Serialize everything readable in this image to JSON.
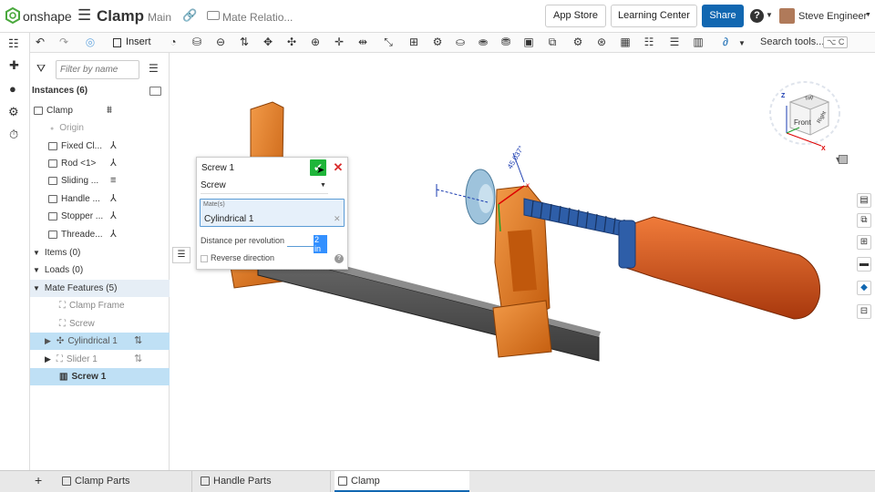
{
  "header": {
    "brand": "onshape",
    "doc_title": "Clamp",
    "branch": "Main",
    "breadcrumb": "Mate Relatio...",
    "app_store": "App Store",
    "learning_center": "Learning Center",
    "share": "Share",
    "help": "?",
    "user_name": "Steve Engineer"
  },
  "toolbar": {
    "insert": "Insert",
    "search_tools": "Search tools...",
    "shortcut": "⌥ C"
  },
  "panel": {
    "filter_placeholder": "Filter by name",
    "instances_label": "Instances (6)",
    "instances": [
      {
        "label": "Clamp"
      },
      {
        "label": "Origin"
      },
      {
        "label": "Fixed Cl..."
      },
      {
        "label": "Rod <1>"
      },
      {
        "label": "Sliding ..."
      },
      {
        "label": "Handle ..."
      },
      {
        "label": "Stopper ..."
      },
      {
        "label": "Threade..."
      }
    ],
    "items_label": "Items (0)",
    "loads_label": "Loads (0)",
    "mate_features_label": "Mate Features (5)",
    "mate_features": [
      {
        "label": "Clamp Frame"
      },
      {
        "label": "Screw"
      },
      {
        "label": "Cylindrical 1"
      },
      {
        "label": "Slider 1"
      },
      {
        "label": "Screw 1"
      }
    ]
  },
  "dialog": {
    "title": "Screw 1",
    "type_value": "Screw",
    "mates_label": "Mate(s)",
    "mates_value": "Cylindrical 1",
    "distance_label": "Distance per revolution",
    "distance_value": "2 in",
    "reverse_label": "Reverse direction",
    "help": "?"
  },
  "viewport": {
    "dimension_label": "45.037°",
    "cube": {
      "top": "Top",
      "front": "Front",
      "right": "Right",
      "z": "Z",
      "x": "X"
    }
  },
  "tabs": [
    {
      "label": "Clamp Parts"
    },
    {
      "label": "Handle Parts"
    },
    {
      "label": "Clamp"
    }
  ],
  "colors": {
    "share_blue": "#1167b1",
    "orange_part": "#d9741c",
    "selected_row": "#bfe0f5",
    "check_green": "#1fb53a",
    "close_red": "#d92c2c",
    "screw_blue": "#2e5ea8"
  }
}
